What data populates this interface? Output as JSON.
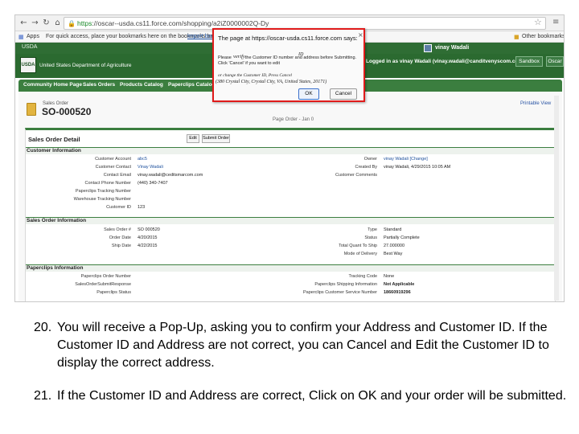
{
  "browser": {
    "url_https": "https",
    "url_rest": "://oscar--usda.cs11.force.com/shopping/a2iZ0000002Q-Dy",
    "apps_label": "Apps",
    "bookmarks_hint": "For quick access, place your bookmarks here on the bookmarks bar.",
    "import_link": "Import bookmarks...",
    "other_bookmarks": "Other bookmarks"
  },
  "header": {
    "usda_mini": "USDA",
    "usda_logo": "USDA",
    "org_name": "United States Department of Agriculture",
    "user_name": "vinay Wadali",
    "logged_in_as": "Logged in as vinay Wadali (vinay.wadali@canditvenyscom.com)",
    "sandbox_label": "Sandbox",
    "oscar_label": "Oscar"
  },
  "tabs": [
    {
      "label": "Community Home Page"
    },
    {
      "label": "Sales Orders"
    },
    {
      "label": "Products Catalog"
    },
    {
      "label": "Paperclips Catalog"
    }
  ],
  "record": {
    "type_label": "Sales Order",
    "number": "SO-000520",
    "printable_link": "Printable View",
    "page_date_label": "Page Order - Jan 0",
    "detail_title": "Sales Order Detail",
    "edit_label": "Edit",
    "submit_label": "Submit Order"
  },
  "sections": {
    "customer": "Customer Information",
    "sales_order": "Sales Order Information",
    "paperclips": "Paperclips Information"
  },
  "customer_fields": [
    {
      "label": "Customer Account",
      "value": "abc5"
    },
    {
      "label": "Customer Contact",
      "value": "Vinay Wadali"
    },
    {
      "label": "Contact Email",
      "value": "vinay.wadali@ceditsmarcom.com"
    },
    {
      "label": "Contact Phone Number",
      "value": "(440) 340-7407"
    },
    {
      "label": "Paperclips Tracking Number",
      "value": ""
    },
    {
      "label": "Warehouse Tracking Number",
      "value": ""
    },
    {
      "label": "Customer ID",
      "value": "123"
    }
  ],
  "customer_right": [
    {
      "label": "Owner",
      "value": "vinay Wadali [Change]"
    },
    {
      "label": "Created By",
      "value": "vinay Wadali, 4/29/2015 10:05 AM"
    },
    {
      "label": "Customer Comments",
      "value": ""
    }
  ],
  "sales_fields": [
    {
      "label": "Sales Order #",
      "value": "SO 000520"
    },
    {
      "label": "Order Date",
      "value": "4/20/2015"
    },
    {
      "label": "Ship Date",
      "value": "4/22/2015"
    }
  ],
  "sales_right": [
    {
      "label": "Type",
      "value": "Standard"
    },
    {
      "label": "Status",
      "value": "Partially Complete"
    },
    {
      "label": "Total Quant To Ship",
      "value": "27.000000"
    },
    {
      "label": "Mode of Delivery",
      "value": "Best Way"
    }
  ],
  "paperclip_fields": [
    {
      "label": "Paperclips Order Number",
      "value": ""
    },
    {
      "label": "SalesOrderSubmitResponse",
      "value": ""
    },
    {
      "label": "Paperclips Status",
      "value": ""
    }
  ],
  "paperclip_right": [
    {
      "label": "Tracking Code",
      "value": "None"
    },
    {
      "label": "Paperclips Shipping Information",
      "value": "Not Applicable"
    },
    {
      "label": "Paperclips Customer Service Number",
      "value": "18660919296"
    }
  ],
  "popup": {
    "title": "The page at https://oscar-usda.cs11.force.com says:",
    "message_start": "Please",
    "message_rest": "the Customer ID number and address before Submitting. Click 'Cancel' if you want to edit",
    "handwritten_verify": "verify",
    "handwritten_id": "ID",
    "handwritten_change": "or change the Customer ID, Press Cancel",
    "handwritten_address": "(380 Crystal City, Crystal City, VA, United States, 20171)",
    "ok_label": "OK",
    "cancel_label": "Cancel"
  },
  "instructions": [
    {
      "num": "20.",
      "text": "You will receive a Pop-Up, asking you to confirm your Address and Customer ID. If the Customer ID and Address are not correct, you can Cancel and Edit the Customer ID to display the correct address."
    },
    {
      "num": "21.",
      "text": "If the Customer ID and Address are correct, Click on OK and your order will be submitted."
    }
  ],
  "colors": {
    "sf_green": "#2b6a30",
    "tab_green": "#3b7e3f",
    "highlight_red": "#e01a1a"
  }
}
